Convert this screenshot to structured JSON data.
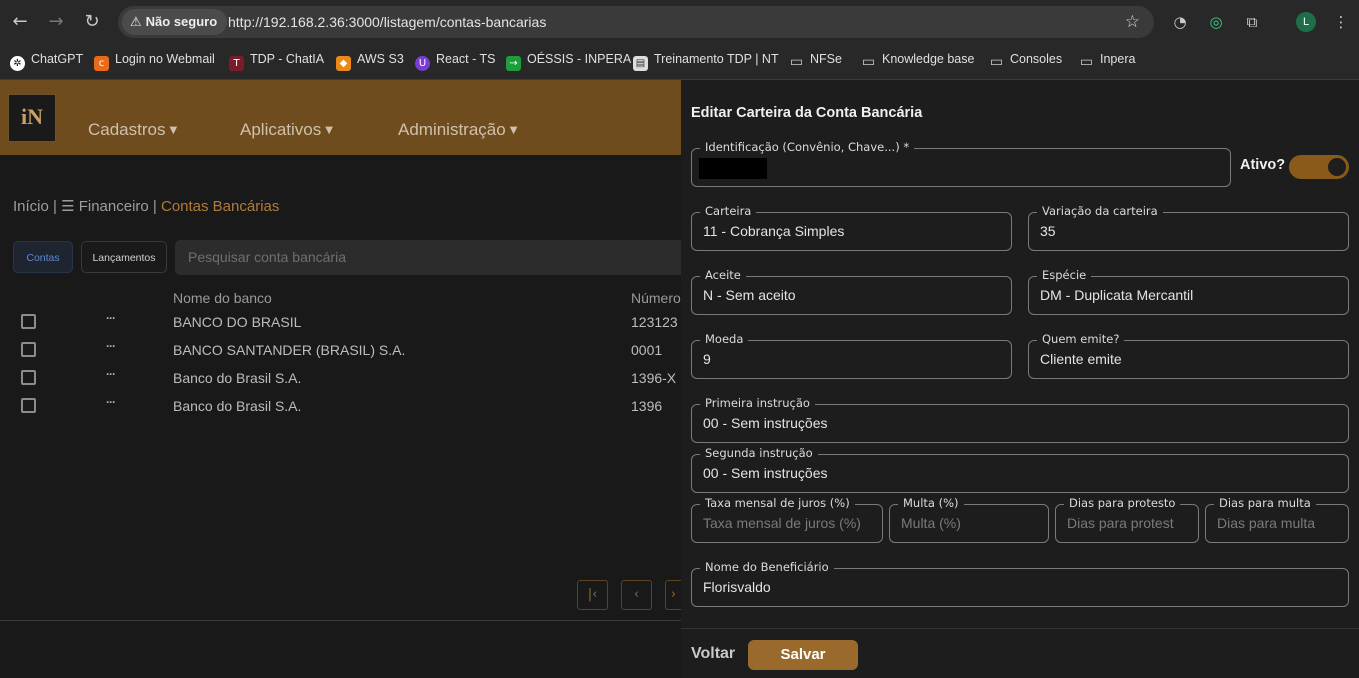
{
  "browser": {
    "security_label": "Não seguro",
    "url": "http://192.168.2.36:3000/listagem/contas-bancarias",
    "profile_initial": "L",
    "bookmarks": [
      {
        "label": "ChatGPT",
        "icon": "openai-icon"
      },
      {
        "label": "Login no Webmail",
        "icon": "cpanel-icon"
      },
      {
        "label": "TDP - ChatIA",
        "icon": "tdp-icon"
      },
      {
        "label": "AWS S3",
        "icon": "aws-icon"
      },
      {
        "label": "React - TS",
        "icon": "react-icon"
      },
      {
        "label": "OÉSSIS - INPERA",
        "icon": "oessis-icon"
      },
      {
        "label": "Treinamento TDP | NT",
        "icon": "doc-icon"
      },
      {
        "label": "NFSe",
        "icon": "folder-icon"
      },
      {
        "label": "Knowledge base",
        "icon": "folder-icon"
      },
      {
        "label": "Consoles",
        "icon": "folder-icon"
      },
      {
        "label": "Inpera",
        "icon": "folder-icon"
      }
    ]
  },
  "app": {
    "logo_text": "iN",
    "menu": [
      "Cadastros",
      "Aplicativos",
      "Administração"
    ],
    "breadcrumb": {
      "home": "Início |",
      "section": "☰ Financeiro |",
      "current": "Contas Bancárias"
    },
    "tabs": {
      "contas": "Contas",
      "lancamentos": "Lançamentos"
    },
    "search_placeholder": "Pesquisar conta bancária",
    "columns": {
      "bank_name": "Nome do banco",
      "number": "Número"
    },
    "rows": [
      {
        "bank": "BANCO DO BRASIL",
        "number": "123123"
      },
      {
        "bank": "BANCO SANTANDER (BRASIL) S.A.",
        "number": "0001"
      },
      {
        "bank": "Banco do Brasil S.A.",
        "number": "1396-X"
      },
      {
        "bank": "Banco do Brasil S.A.",
        "number": "1396"
      }
    ],
    "row_menu": "···"
  },
  "drawer": {
    "title": "Editar Carteira da Conta Bancária",
    "active_label": "Ativo?",
    "active_on": true,
    "fields": {
      "identificacao": {
        "label": "Identificação (Convênio, Chave...) *"
      },
      "carteira": {
        "label": "Carteira",
        "value": "11 - Cobrança Simples"
      },
      "variacao": {
        "label": "Variação da carteira",
        "value": "35"
      },
      "aceite": {
        "label": "Aceite",
        "value": "N - Sem aceito"
      },
      "especie": {
        "label": "Espécie",
        "value": "DM - Duplicata Mercantil"
      },
      "moeda": {
        "label": "Moeda",
        "value": "9"
      },
      "quem_emite": {
        "label": "Quem emite?",
        "value": "Cliente emite"
      },
      "primeira_instrucao": {
        "label": "Primeira instrução",
        "value": "00 - Sem instruções"
      },
      "segunda_instrucao": {
        "label": "Segunda instrução",
        "value": "00 - Sem instruções"
      },
      "taxa_juros": {
        "label": "Taxa mensal de juros (%)",
        "placeholder": "Taxa mensal de juros (%)"
      },
      "multa": {
        "label": "Multa (%)",
        "placeholder": "Multa (%)"
      },
      "dias_protesto": {
        "label": "Dias para protesto",
        "placeholder": "Dias para protest"
      },
      "dias_multa": {
        "label": "Dias para multa",
        "placeholder": "Dias para multa"
      },
      "beneficiario": {
        "label": "Nome do Beneficiário",
        "value": "Florisvaldo"
      }
    },
    "back_label": "Voltar",
    "save_label": "Salvar"
  },
  "colors": {
    "accent": "#9a6a2c",
    "header": "#6e4c1e",
    "breadcrumb_active": "#b07b3a"
  }
}
